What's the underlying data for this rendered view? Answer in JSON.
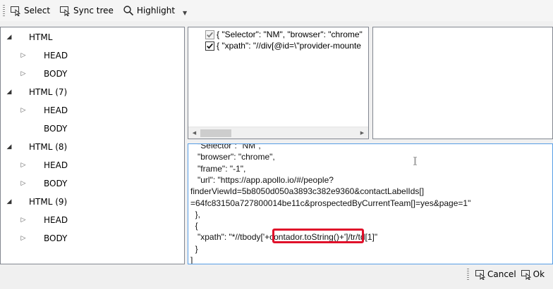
{
  "toolbar": {
    "select_label": "Select",
    "sync_tree_label": "Sync tree",
    "highlight_label": "Highlight"
  },
  "tree": {
    "nodes": [
      {
        "label": "HTML",
        "level": 0,
        "expanded": true
      },
      {
        "label": "HEAD",
        "level": 1,
        "expanded": false
      },
      {
        "label": "BODY",
        "level": 1,
        "expanded": false
      },
      {
        "label": "HTML (7)",
        "level": 0,
        "expanded": true
      },
      {
        "label": "HEAD",
        "level": 1,
        "expanded": false
      },
      {
        "label": "BODY",
        "level": 1,
        "expanded": null
      },
      {
        "label": "HTML (8)",
        "level": 0,
        "expanded": true
      },
      {
        "label": "HEAD",
        "level": 1,
        "expanded": false
      },
      {
        "label": "BODY",
        "level": 1,
        "expanded": false
      },
      {
        "label": "HTML (9)",
        "level": 0,
        "expanded": true
      },
      {
        "label": "HEAD",
        "level": 1,
        "expanded": false
      },
      {
        "label": "BODY",
        "level": 1,
        "expanded": false
      }
    ]
  },
  "attributes": {
    "items": [
      {
        "text": "{   \"Selector\": \"NM\",   \"browser\": \"chrome\"",
        "checked": true,
        "dim": true
      },
      {
        "text": "{   \"xpath\": \"//div[@id=\\\"provider-mounte",
        "checked": true,
        "dim": false
      }
    ]
  },
  "editor": {
    "lines": [
      "   \"Selector\": \"NM\",",
      "   \"browser\": \"chrome\",",
      "   \"frame\": \"-1\",",
      "   \"url\": \"https://app.apollo.io/#/people?",
      "finderViewId=5b8050d050a3893c382e9360&contactLabelIds[]",
      "=64fc83150a727800014be11c&prospectedByCurrentTeam[]=yes&page=1\"",
      "  },",
      "  {",
      "   \"xpath\": \"*//tbody['+contador.toString()+']/tr/td[1]\"",
      "  }",
      "]"
    ]
  },
  "footer": {
    "cancel_label": "Cancel",
    "ok_label": "Ok"
  }
}
